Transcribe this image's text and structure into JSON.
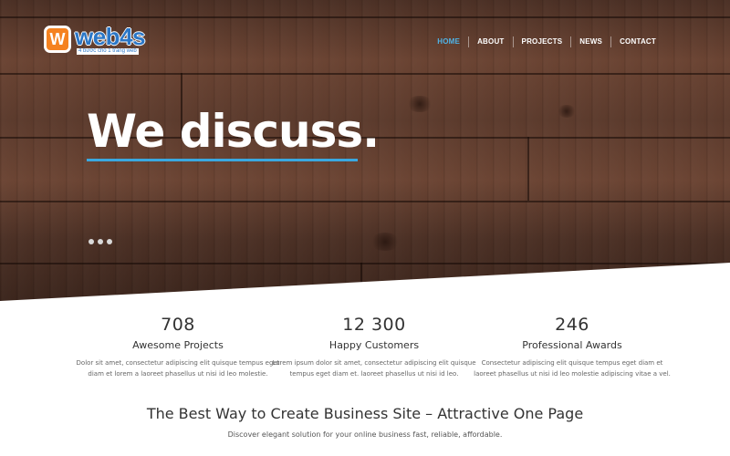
{
  "logo": {
    "mark": "W",
    "name": "web4s",
    "tagline": "4 bước cho 1 trang web"
  },
  "nav": {
    "items": [
      {
        "label": "HOME",
        "active": true
      },
      {
        "label": "ABOUT",
        "active": false
      },
      {
        "label": "PROJECTS",
        "active": false
      },
      {
        "label": "NEWS",
        "active": false
      },
      {
        "label": "CONTACT",
        "active": false
      }
    ]
  },
  "hero": {
    "headline": "We discuss.",
    "accent_color": "#3aa8e0",
    "slider_dots": 3
  },
  "stats": [
    {
      "number": "708",
      "label": "Awesome Projects",
      "description": "Dolor sit amet, consectetur adipiscing elit quisque tempus eget diam et lorem a laoreet phasellus ut nisi id leo molestie."
    },
    {
      "number": "12 300",
      "label": "Happy Customers",
      "description": "Lorem ipsum dolor sit amet, consectetur adipiscing elit quisque tempus eget diam et. laoreet phasellus ut nisi id leo."
    },
    {
      "number": "246",
      "label": "Professional Awards",
      "description": "Consectetur adipiscing elit quisque tempus eget diam et laoreet phasellus ut nisi id leo molestie adipiscing vitae a vel."
    }
  ],
  "section": {
    "title": "The Best Way to Create Business Site – Attractive One Page",
    "subtitle": "Discover elegant solution for your online business fast, reliable, affordable."
  }
}
